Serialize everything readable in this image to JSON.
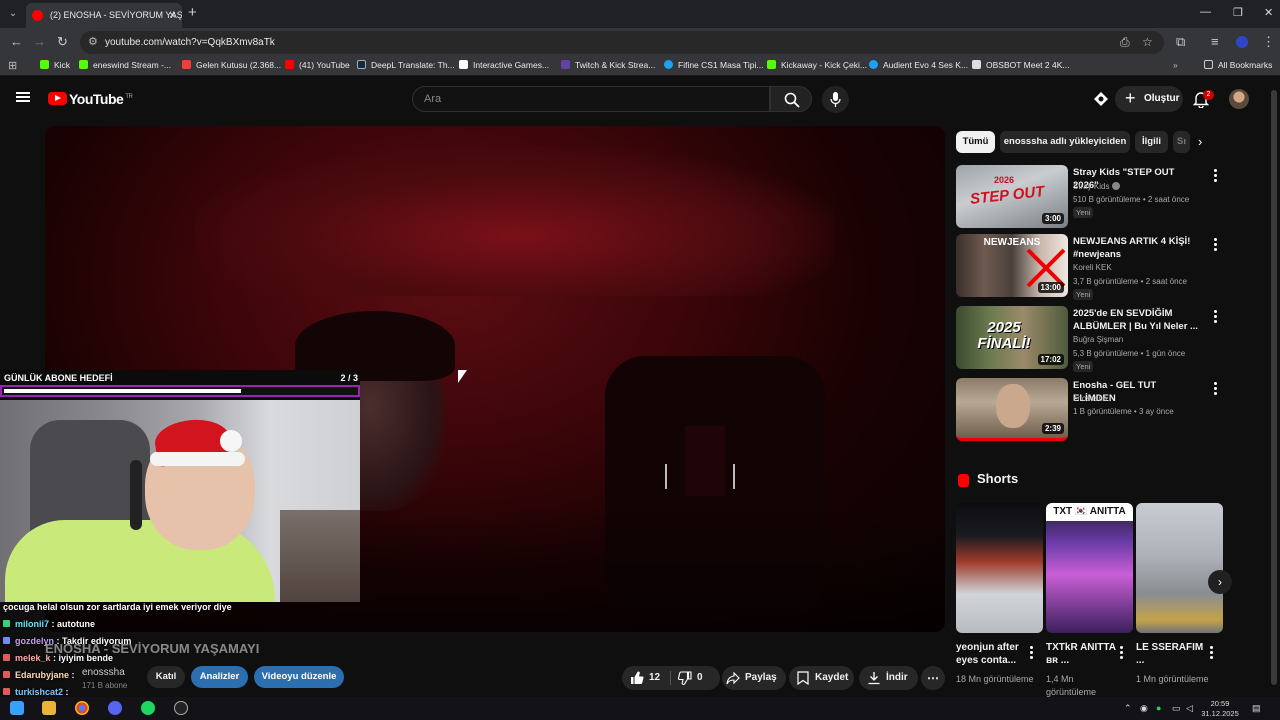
{
  "browser": {
    "tab_title": "(2) ENOSHA - SEVİYORUM YAŞ",
    "url": "youtube.com/watch?v=QqkBXmv8aTk",
    "bookmarks": [
      {
        "label": "Kick",
        "color": "#53fc18"
      },
      {
        "label": "eneswind Stream -...",
        "color": "#53fc18"
      },
      {
        "label": "Gelen Kutusu (2.368...",
        "color": "#ea4335"
      },
      {
        "label": "(41) YouTube",
        "color": "#ff0000"
      },
      {
        "label": "DeepL Translate: Th...",
        "color": "#0f2b46"
      },
      {
        "label": "Interactive Games...",
        "color": "#ffffff"
      },
      {
        "label": "Twitch & Kick Strea...",
        "color": "#6441a5"
      },
      {
        "label": "Fifine CS1 Masa Tipi...",
        "color": "#1da1f2"
      },
      {
        "label": "Kickaway - Kick Çeki...",
        "color": "#53fc18"
      },
      {
        "label": "Audient Evo 4 Ses K...",
        "color": "#1da1f2"
      },
      {
        "label": "OBSBOT Meet 2 4K...",
        "color": "#dddddd"
      }
    ],
    "all_bookmarks": "All Bookmarks"
  },
  "youtube": {
    "logo_text": "YouTube",
    "logo_region": "TR",
    "search_placeholder": "Ara",
    "create_label": "Oluştur",
    "notifications": "2"
  },
  "overlay": {
    "goal_title": "GÜNLÜK ABONE HEDEFİ",
    "goal_count": "2 / 3",
    "goal_progress": 0.667,
    "chat": [
      {
        "user": "",
        "text": "çocuga helal olsun zor sartlarda iyi emek veriyor diye"
      },
      {
        "user": "milonii7",
        "text": ": autotune"
      },
      {
        "user": "gozdelyn",
        "text": ": Takdir ediyorum"
      },
      {
        "user": "melek_k",
        "text": ": iyiyim bende"
      },
      {
        "user": "Edarubyjane",
        "text": ":"
      },
      {
        "user": "turkishcat2",
        "text": ":"
      }
    ]
  },
  "video": {
    "title": "ENOSHA - SEVİYORUM YAŞAMAYI",
    "channel": "enosssha",
    "subscribers": "171 B abone",
    "join_label": "Katıl",
    "analytics_label": "Analizler",
    "edit_label": "Videoyu düzenle",
    "likes": "12",
    "dislikes": "0",
    "share_label": "Paylaş",
    "save_label": "Kaydet",
    "download_label": "İndir"
  },
  "chips": [
    "Tümü",
    "enosssha adlı yükleyiciden",
    "İlgili",
    "Sı"
  ],
  "recommendations": [
    {
      "title": "Stray Kids \"STEP OUT 2026\"",
      "channel": "Stray Kids",
      "meta": "510 B görüntüleme • 2 saat önce",
      "badge": "Yeni",
      "duration": "3:00"
    },
    {
      "title": "NEWJEANS ARTIK 4 KİŞİ! #newjeans",
      "channel": "Koreli KEK",
      "meta": "3,7 B görüntüleme • 2 saat önce",
      "badge": "Yeni",
      "duration": "13:00"
    },
    {
      "title": "2025'de EN SEVDİĞİM ALBÜMLER | Bu Yıl Neler ...",
      "channel": "Buğra Şişman",
      "meta": "5,3 B görüntüleme • 1 gün önce",
      "badge": "Yeni",
      "duration": "17:02"
    },
    {
      "title": "Enosha - GEL TUT ELİMDEN",
      "channel": "enosssha",
      "meta": "1 B görüntüleme • 3 ay önce",
      "badge": "",
      "duration": "2:39"
    }
  ],
  "shorts": {
    "header": "Shorts",
    "items": [
      {
        "title": "yeonjun after eyes conta...",
        "views": "18 Mn görüntüleme"
      },
      {
        "title": "TXTkR ANITTA ʙʀ ...",
        "views": "1,4 Mn görüntüleme"
      },
      {
        "title": "LE SSERAFIM ...",
        "views": "1 Mn görüntüleme"
      }
    ],
    "short2_caption": "TXT 🇰🇷 ANITTA"
  },
  "taskbar": {
    "time": "20:59",
    "date": "31.12.2025"
  },
  "thumb_texts": {
    "t1": "2026",
    "t1b": "STEP OUT",
    "t2": "NEWJEANS",
    "t3": "2025 FİNALİ!"
  }
}
